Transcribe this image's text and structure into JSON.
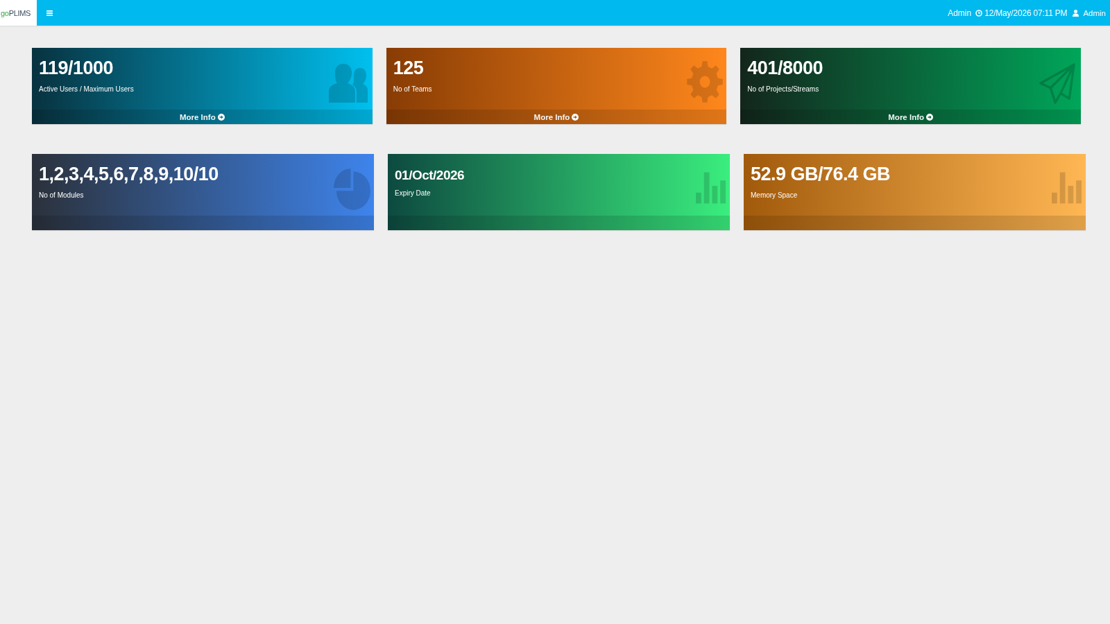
{
  "header": {
    "logo": {
      "accent": "go",
      "text": "PLIMS"
    },
    "user": "Admin",
    "datetime": "12/May/2026 07:11 PM",
    "account": "Admin"
  },
  "dashboard": {
    "rows": [
      {
        "cards": [
          {
            "value": "119/1000",
            "label": "Active Users / Maximum Users",
            "kind": "users",
            "link": "More Info"
          },
          {
            "value": "125",
            "label": "No of Teams",
            "kind": "gear",
            "link": "More Info"
          },
          {
            "value": "401/8000",
            "label": "No of Projects/Streams",
            "kind": "paper-plane",
            "link": "More Info"
          }
        ]
      },
      {
        "cards": [
          {
            "value": "1,2,3,4,5,6,7,8,9,10/10",
            "label": "No of Modules",
            "kind": "pie"
          },
          {
            "value": "01/Oct/2026",
            "label": "Expiry Date",
            "kind": "bar-chart"
          },
          {
            "value": "52.9 GB/76.4 GB",
            "label": "Memory Space",
            "kind": "bar-chart"
          }
        ]
      }
    ]
  }
}
